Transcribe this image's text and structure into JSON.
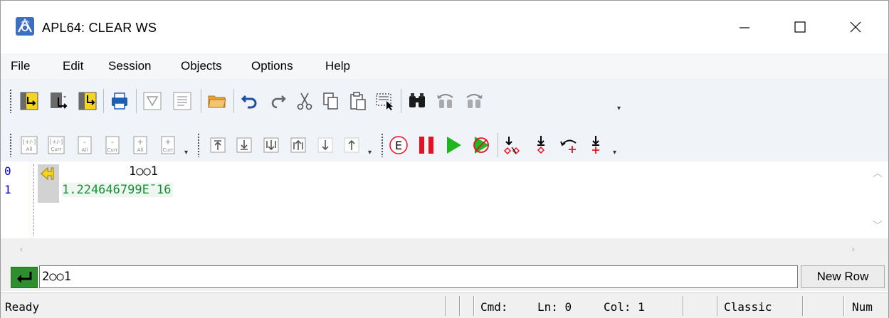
{
  "window": {
    "title": "APL64: CLEAR WS",
    "controls": [
      "minimize-icon",
      "maximize-icon",
      "close-icon"
    ]
  },
  "menu": {
    "items": [
      "File",
      "Edit",
      "Session",
      "Objects",
      "Options",
      "Help"
    ]
  },
  "toolbar1": {
    "icons": [
      "jump-icon",
      "step-over-icon",
      "step-into-icon",
      "print-icon",
      "filter-icon",
      "document-icon",
      "open-folder-icon",
      "undo-icon",
      "redo-icon",
      "cut-icon",
      "copy-icon",
      "paste-icon",
      "select-icon",
      "find-icon",
      "find-prev-icon",
      "find-next-icon"
    ]
  },
  "toolbar2": {
    "labels": {
      "expand_all": "[+/-]",
      "all": "All",
      "curr": "Curr"
    },
    "icons": [
      "toggle-all-icon",
      "toggle-curr-icon",
      "collapse-all-icon",
      "collapse-curr-icon",
      "expand-all-icon",
      "expand-curr-icon",
      "go-top-icon",
      "go-bottom-icon",
      "next-block-icon",
      "prev-block-icon",
      "down-arrow-icon",
      "up-arrow-icon",
      "error-icon",
      "pause-icon",
      "run-icon",
      "stop-run-icon",
      "clear-stops-icon",
      "stop-icon",
      "trace-icon",
      "trace-add-icon"
    ]
  },
  "session": {
    "line_numbers": [
      "0",
      "1"
    ],
    "lines": [
      "1○○1",
      "1.224646799E¯16"
    ]
  },
  "input": {
    "value": "2○○1",
    "new_row_label": "New Row"
  },
  "status": {
    "ready": "Ready",
    "cmd": "Cmd:",
    "ln": "Ln: 0",
    "col": "Col: 1",
    "mode": "Classic",
    "num": "Num"
  },
  "colors": {
    "toolbar_bg": "#f0f3f8",
    "line_number": "#0000c8",
    "result_text": "#1a8f3a",
    "enter_button": "#2f8f2f",
    "run_green": "#22b522",
    "pause_red": "#e81123"
  }
}
